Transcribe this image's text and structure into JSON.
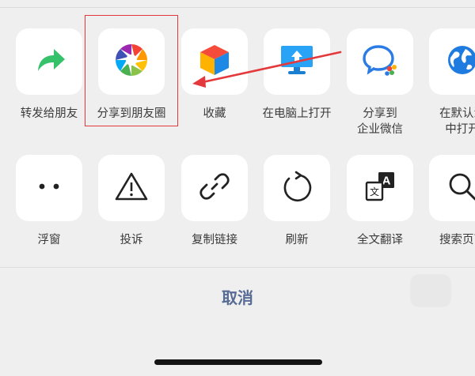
{
  "share_sheet": {
    "row1": [
      {
        "label": "转发给朋友",
        "icon": "share-forward-icon"
      },
      {
        "label": "分享到朋友圈",
        "icon": "moments-icon"
      },
      {
        "label": "收藏",
        "icon": "favorites-icon"
      },
      {
        "label": "在电脑上打开",
        "icon": "open-on-computer-icon"
      },
      {
        "label": "分享到\n企业微信",
        "icon": "wecom-icon"
      },
      {
        "label": "在默认浏\n中打开",
        "icon": "browser-globe-icon"
      }
    ],
    "row2": [
      {
        "label": "浮窗",
        "icon": "float-window-icon"
      },
      {
        "label": "投诉",
        "icon": "warning-icon"
      },
      {
        "label": "复制链接",
        "icon": "link-icon"
      },
      {
        "label": "刷新",
        "icon": "refresh-icon"
      },
      {
        "label": "全文翻译",
        "icon": "translate-icon"
      },
      {
        "label": "搜索页面",
        "icon": "search-icon"
      }
    ],
    "cancel_label": "取消"
  },
  "colors": {
    "accent_blue": "#576b95",
    "highlight_red": "#e4393c",
    "share_green": "#35c26b"
  }
}
